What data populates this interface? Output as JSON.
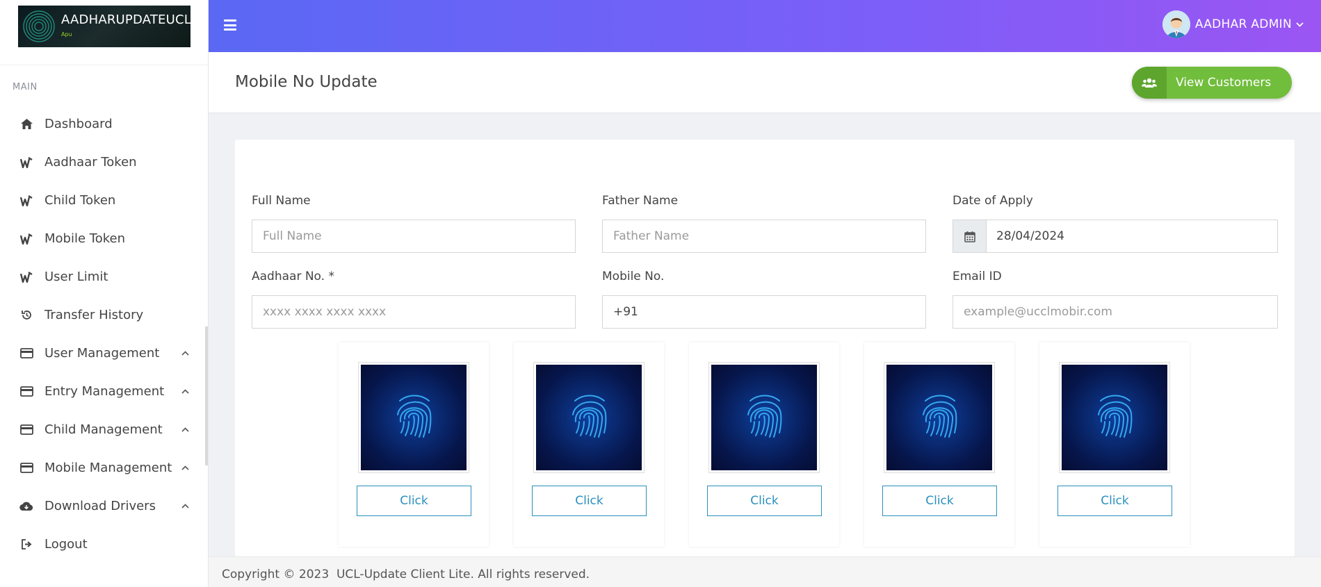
{
  "brand": {
    "title": "AADHARUPDATEUCL",
    "subtitle": "Apu"
  },
  "sidebar": {
    "section_label": "MAIN",
    "items": [
      {
        "label": "Dashboard",
        "icon": "home-icon"
      },
      {
        "label": "Aadhaar Token",
        "icon": "token-icon"
      },
      {
        "label": "Child Token",
        "icon": "token-icon"
      },
      {
        "label": "Mobile Token",
        "icon": "token-icon"
      },
      {
        "label": "User Limit",
        "icon": "token-icon"
      },
      {
        "label": "Transfer History",
        "icon": "history-icon"
      },
      {
        "label": "User Management",
        "icon": "card-icon",
        "expandable": true
      },
      {
        "label": "Entry Management",
        "icon": "card-icon",
        "expandable": true
      },
      {
        "label": "Child Management",
        "icon": "card-icon",
        "expandable": true
      },
      {
        "label": "Mobile Management",
        "icon": "card-icon",
        "expandable": true
      },
      {
        "label": "Download Drivers",
        "icon": "cloud-download-icon",
        "expandable": true
      },
      {
        "label": "Logout",
        "icon": "logout-icon"
      }
    ]
  },
  "header": {
    "admin_name": "AADHAR ADMIN",
    "gradient_start": "#5a68f4",
    "gradient_end": "#9b55f3"
  },
  "page": {
    "title": "Mobile No Update",
    "view_customers_label": "View Customers",
    "accent_green": "#71bd3c"
  },
  "form": {
    "full_name": {
      "label": "Full Name",
      "placeholder": "Full Name",
      "value": ""
    },
    "father_name": {
      "label": "Father Name",
      "placeholder": "Father Name",
      "value": ""
    },
    "date_of_apply": {
      "label": "Date of Apply",
      "value": "28/04/2024"
    },
    "aadhaar_no": {
      "label": "Aadhaar No. *",
      "placeholder": "xxxx xxxx xxxx xxxx",
      "value": ""
    },
    "mobile_no": {
      "label": "Mobile No.",
      "value": "+91"
    },
    "email_id": {
      "label": "Email ID",
      "placeholder": "example@ucclmobir.com",
      "value": ""
    }
  },
  "fingerprints": [
    {
      "button_label": "Click"
    },
    {
      "button_label": "Click"
    },
    {
      "button_label": "Click"
    },
    {
      "button_label": "Click"
    },
    {
      "button_label": "Click"
    }
  ],
  "footer": {
    "text": "Copyright © 2023  UCL-Update Client Lite. All rights reserved."
  }
}
